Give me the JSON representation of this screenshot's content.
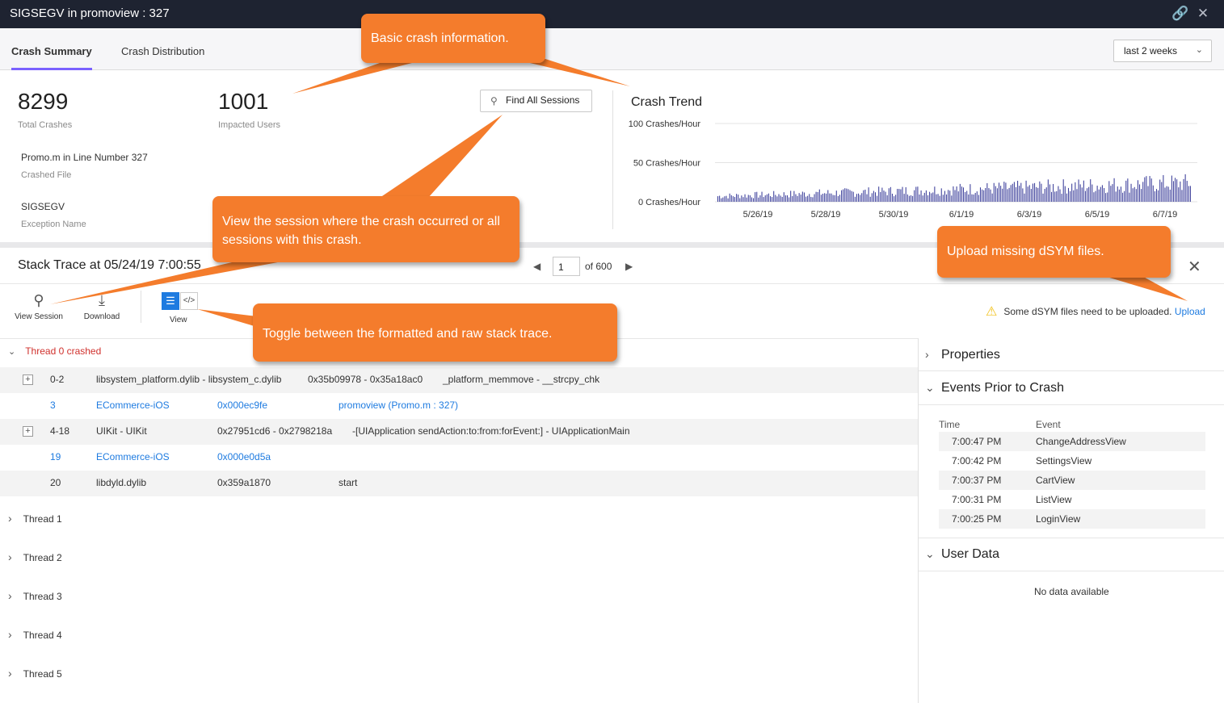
{
  "window": {
    "title": "SIGSEGV in promoview : 327",
    "link_icon": "link-icon",
    "close_icon": "close-icon"
  },
  "tabs": [
    {
      "label": "Crash Summary",
      "active": true
    },
    {
      "label": "Crash Distribution",
      "active": false
    }
  ],
  "range": {
    "value": "last 2 weeks"
  },
  "summary": {
    "total_crashes": "8299",
    "total_crashes_label": "Total Crashes",
    "impacted_users": "1001",
    "impacted_users_label": "Impacted Users",
    "crashed_file": "Promo.m in Line Number 327",
    "crashed_file_label": "Crashed File",
    "exception_name": "SIGSEGV",
    "exception_name_label": "Exception Name",
    "find_sessions_label": "Find All Sessions"
  },
  "chart_data": {
    "type": "bar",
    "title": "Crash Trend",
    "y_ticks": [
      "100 Crashes/Hour",
      "50 Crashes/Hour",
      "0 Crashes/Hour"
    ],
    "ylim": [
      0,
      100
    ],
    "x_ticks": [
      "5/26/19",
      "5/28/19",
      "5/30/19",
      "6/1/19",
      "6/3/19",
      "6/5/19",
      "6/7/19"
    ],
    "x_range": [
      "5/24/19",
      "6/7/19"
    ],
    "bar_count": 280,
    "trend_start": 8,
    "trend_end": 27,
    "grid": true,
    "bar_color": "#3a3d9a"
  },
  "stack_trace": {
    "title": "Stack Trace at 05/24/19 7:00:55",
    "page": "1",
    "page_of": "of 600",
    "toolbar": {
      "view_session": "View Session",
      "download": "Download",
      "view": "View"
    },
    "warning": "Some dSYM files need to be uploaded.",
    "upload_link": "Upload",
    "thread0_label": "Thread 0 crashed",
    "rows": [
      {
        "frame": "0-2",
        "module": "libsystem_platform.dylib - libsystem_c.dylib",
        "address": "0x35b09978 - 0x35a18ac0",
        "symbol": "_platform_memmove - __strcpy_chk"
      },
      {
        "frame": "3",
        "module": "ECommerce-iOS",
        "address": "0x000ec9fe",
        "symbol": "promoview (Promo.m : 327)"
      },
      {
        "frame": "4-18",
        "module": "UIKit - UIKit",
        "address": "0x27951cd6 - 0x2798218a",
        "symbol": "-[UIApplication sendAction:to:from:forEvent:] - UIApplicationMain"
      },
      {
        "frame": "19",
        "module": "ECommerce-iOS",
        "address": "0x000e0d5a",
        "symbol": ""
      },
      {
        "frame": "20",
        "module": "libdyld.dylib",
        "address": "0x359a1870",
        "symbol": "start"
      }
    ],
    "threads": [
      "Thread 1",
      "Thread 2",
      "Thread 3",
      "Thread 4",
      "Thread 5"
    ]
  },
  "side_panel": {
    "properties": "Properties",
    "events_title": "Events Prior to Crash",
    "events_headers": {
      "time": "Time",
      "event": "Event"
    },
    "events": [
      {
        "time": "7:00:47 PM",
        "event": "ChangeAddressView"
      },
      {
        "time": "7:00:42 PM",
        "event": "SettingsView"
      },
      {
        "time": "7:00:37 PM",
        "event": "CartView"
      },
      {
        "time": "7:00:31 PM",
        "event": "ListView"
      },
      {
        "time": "7:00:25 PM",
        "event": "LoginView"
      }
    ],
    "user_data_title": "User Data",
    "no_data": "No data available"
  },
  "callouts": {
    "basic": "Basic crash information.",
    "session": "View the session where the crash occurred or all sessions with this crash.",
    "upload": "Upload missing dSYM files.",
    "toggle": "Toggle between the formatted and raw stack trace."
  }
}
